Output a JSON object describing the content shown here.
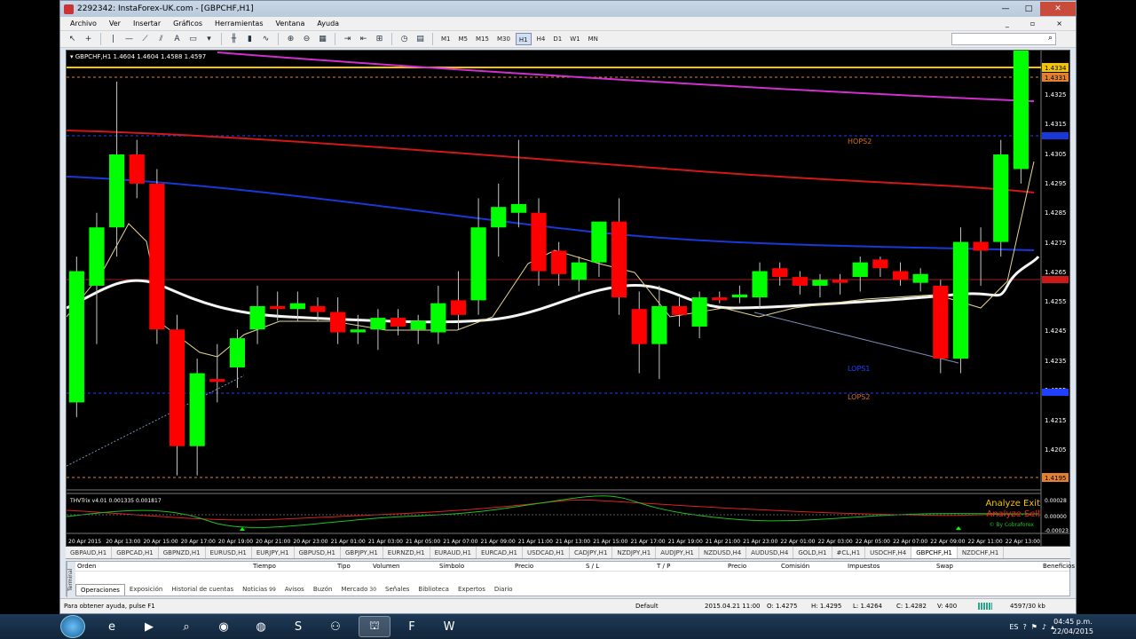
{
  "window": {
    "title": "2292342: InstaForex-UK.com - [GBPCHF,H1]",
    "menu": [
      "Archivo",
      "Ver",
      "Insertar",
      "Gráficos",
      "Herramientas",
      "Ventana",
      "Ayuda"
    ]
  },
  "toolbar": {
    "timeframes": [
      "M1",
      "M5",
      "M15",
      "M30",
      "H1",
      "H4",
      "D1",
      "W1",
      "MN"
    ],
    "active_timeframe": "H1"
  },
  "chart": {
    "header": "GBPCHF,H1  1.4604 1.4604 1.4588 1.4597",
    "price_labels": [
      "1.4325",
      "1.4315",
      "1.4305",
      "1.4295",
      "1.4285",
      "1.4275",
      "1.4265",
      "1.4255",
      "1.4245",
      "1.4235",
      "1.4225",
      "1.4215",
      "1.4205",
      "1.4195"
    ],
    "highlight_labels": [
      {
        "text": "1.4334",
        "color": "#f5c400"
      },
      {
        "text": "1.4331",
        "color": "#e08030"
      },
      {
        "text": "1.4195",
        "color": "#e08030"
      }
    ],
    "levels": [
      {
        "text": "HOPS2",
        "color": "#d07020"
      },
      {
        "text": "LOPS1",
        "color": "#2040ff"
      },
      {
        "text": "LOPS2",
        "color": "#d07020"
      }
    ],
    "time_labels": [
      "20 Apr 2015",
      "20 Apr 13:00",
      "20 Apr 15:00",
      "20 Apr 17:00",
      "20 Apr 19:00",
      "20 Apr 21:00",
      "20 Apr 23:00",
      "21 Apr 01:00",
      "21 Apr 03:00",
      "21 Apr 05:00",
      "21 Apr 07:00",
      "21 Apr 09:00",
      "21 Apr 11:00",
      "21 Apr 13:00",
      "21 Apr 15:00",
      "21 Apr 17:00",
      "21 Apr 19:00",
      "21 Apr 21:00",
      "21 Apr 23:00",
      "22 Apr 01:00",
      "22 Apr 03:00",
      "22 Apr 05:00",
      "22 Apr 07:00",
      "22 Apr 09:00",
      "22 Apr 11:00",
      "22 Apr 13:00"
    ],
    "indicator_header": "THVTrix v4.01 0.001335 0.001817",
    "indicator_labels": [
      "0.00028",
      "0.00000",
      "-0.00023"
    ],
    "watermark": [
      "Analyze Exit",
      "Analyze Sell",
      "© By Cobraforex"
    ]
  },
  "chart_data": {
    "type": "candlestick",
    "ylim": [
      1.419,
      1.434
    ],
    "candles": [
      {
        "o": 1.422,
        "h": 1.427,
        "l": 1.4215,
        "c": 1.4265,
        "color": "green"
      },
      {
        "o": 1.426,
        "h": 1.4285,
        "l": 1.424,
        "c": 1.428,
        "color": "green"
      },
      {
        "o": 1.428,
        "h": 1.433,
        "l": 1.427,
        "c": 1.4305,
        "color": "green"
      },
      {
        "o": 1.4305,
        "h": 1.431,
        "l": 1.429,
        "c": 1.4295,
        "color": "red"
      },
      {
        "o": 1.4295,
        "h": 1.43,
        "l": 1.424,
        "c": 1.4245,
        "color": "red"
      },
      {
        "o": 1.4245,
        "h": 1.425,
        "l": 1.4195,
        "c": 1.4205,
        "color": "red"
      },
      {
        "o": 1.4205,
        "h": 1.4235,
        "l": 1.4195,
        "c": 1.423,
        "color": "green"
      },
      {
        "o": 1.4228,
        "h": 1.424,
        "l": 1.422,
        "c": 1.4227,
        "color": "red"
      },
      {
        "o": 1.4232,
        "h": 1.4245,
        "l": 1.4225,
        "c": 1.4242,
        "color": "green"
      },
      {
        "o": 1.4245,
        "h": 1.426,
        "l": 1.424,
        "c": 1.4253,
        "color": "green"
      },
      {
        "o": 1.4253,
        "h": 1.4258,
        "l": 1.4248,
        "c": 1.4252,
        "color": "red"
      },
      {
        "o": 1.4252,
        "h": 1.4258,
        "l": 1.4248,
        "c": 1.4254,
        "color": "green"
      },
      {
        "o": 1.4253,
        "h": 1.4256,
        "l": 1.4248,
        "c": 1.4251,
        "color": "red"
      },
      {
        "o": 1.4251,
        "h": 1.4256,
        "l": 1.424,
        "c": 1.4244,
        "color": "red"
      },
      {
        "o": 1.4244,
        "h": 1.425,
        "l": 1.424,
        "c": 1.4245,
        "color": "green"
      },
      {
        "o": 1.4245,
        "h": 1.4252,
        "l": 1.4238,
        "c": 1.4249,
        "color": "green"
      },
      {
        "o": 1.4249,
        "h": 1.4252,
        "l": 1.4243,
        "c": 1.4246,
        "color": "red"
      },
      {
        "o": 1.4245,
        "h": 1.425,
        "l": 1.424,
        "c": 1.4248,
        "color": "green"
      },
      {
        "o": 1.4244,
        "h": 1.426,
        "l": 1.424,
        "c": 1.4254,
        "color": "green"
      },
      {
        "o": 1.425,
        "h": 1.4265,
        "l": 1.4245,
        "c": 1.4255,
        "color": "red"
      },
      {
        "o": 1.4255,
        "h": 1.429,
        "l": 1.425,
        "c": 1.428,
        "color": "green"
      },
      {
        "o": 1.428,
        "h": 1.4295,
        "l": 1.427,
        "c": 1.4287,
        "color": "green"
      },
      {
        "o": 1.4288,
        "h": 1.431,
        "l": 1.428,
        "c": 1.4285,
        "color": "green"
      },
      {
        "o": 1.4285,
        "h": 1.429,
        "l": 1.426,
        "c": 1.4265,
        "color": "red"
      },
      {
        "o": 1.4272,
        "h": 1.4275,
        "l": 1.426,
        "c": 1.4264,
        "color": "red"
      },
      {
        "o": 1.4262,
        "h": 1.427,
        "l": 1.4258,
        "c": 1.4268,
        "color": "green"
      },
      {
        "o": 1.4268,
        "h": 1.4282,
        "l": 1.4263,
        "c": 1.4282,
        "color": "green"
      },
      {
        "o": 1.4282,
        "h": 1.429,
        "l": 1.425,
        "c": 1.4256,
        "color": "red"
      },
      {
        "o": 1.4252,
        "h": 1.4258,
        "l": 1.423,
        "c": 1.424,
        "color": "red"
      },
      {
        "o": 1.424,
        "h": 1.426,
        "l": 1.4228,
        "c": 1.4253,
        "color": "green"
      },
      {
        "o": 1.4253,
        "h": 1.4256,
        "l": 1.4246,
        "c": 1.425,
        "color": "red"
      },
      {
        "o": 1.4246,
        "h": 1.4258,
        "l": 1.4242,
        "c": 1.4256,
        "color": "green"
      },
      {
        "o": 1.4256,
        "h": 1.4258,
        "l": 1.4254,
        "c": 1.4255,
        "color": "red"
      },
      {
        "o": 1.4256,
        "h": 1.426,
        "l": 1.4254,
        "c": 1.4257,
        "color": "green"
      },
      {
        "o": 1.4256,
        "h": 1.4268,
        "l": 1.4252,
        "c": 1.4265,
        "color": "green"
      },
      {
        "o": 1.4266,
        "h": 1.4268,
        "l": 1.426,
        "c": 1.4263,
        "color": "red"
      },
      {
        "o": 1.4263,
        "h": 1.4265,
        "l": 1.4257,
        "c": 1.426,
        "color": "red"
      },
      {
        "o": 1.426,
        "h": 1.4264,
        "l": 1.4256,
        "c": 1.4262,
        "color": "green"
      },
      {
        "o": 1.4261,
        "h": 1.4264,
        "l": 1.4257,
        "c": 1.4262,
        "color": "red"
      },
      {
        "o": 1.4263,
        "h": 1.427,
        "l": 1.4258,
        "c": 1.4268,
        "color": "green"
      },
      {
        "o": 1.4269,
        "h": 1.427,
        "l": 1.4263,
        "c": 1.4266,
        "color": "red"
      },
      {
        "o": 1.4265,
        "h": 1.4268,
        "l": 1.426,
        "c": 1.4262,
        "color": "red"
      },
      {
        "o": 1.4261,
        "h": 1.4266,
        "l": 1.4258,
        "c": 1.4264,
        "color": "green"
      },
      {
        "o": 1.426,
        "h": 1.4262,
        "l": 1.423,
        "c": 1.4235,
        "color": "red"
      },
      {
        "o": 1.4235,
        "h": 1.428,
        "l": 1.423,
        "c": 1.4275,
        "color": "green"
      },
      {
        "o": 1.4275,
        "h": 1.428,
        "l": 1.426,
        "c": 1.4272,
        "color": "red"
      },
      {
        "o": 1.4275,
        "h": 1.431,
        "l": 1.427,
        "c": 1.4305,
        "color": "green"
      },
      {
        "o": 1.43,
        "h": 1.4342,
        "l": 1.4295,
        "c": 1.4342,
        "color": "green"
      }
    ]
  },
  "symbol_tabs": [
    "GBPAUD,H1",
    "GBPCAD,H1",
    "GBPNZD,H1",
    "EURUSD,H1",
    "EURJPY,H1",
    "GBPUSD,H1",
    "GBPJPY,H1",
    "EURNZD,H1",
    "EURAUD,H1",
    "EURCAD,H1",
    "USDCAD,H1",
    "CADJPY,H1",
    "NZDJPY,H1",
    "AUDJPY,H1",
    "NZDUSD,H4",
    "AUDUSD,H4",
    "GOLD,H1",
    "#CL,H1",
    "USDCHF,H4",
    "GBPCHF,H1",
    "NZDCHF,H1"
  ],
  "active_symbol_tab": "GBPCHF,H1",
  "terminal": {
    "side_label": "Terminal",
    "columns": [
      "Orden",
      "Tiempo",
      "Tipo",
      "Volumen",
      "Símbolo",
      "Precio",
      "S / L",
      "T / P",
      "Precio",
      "Comisión",
      "Impuestos",
      "Swap",
      "Beneficios"
    ],
    "tabs": [
      "Operaciones",
      "Exposición",
      "Historial de cuentas",
      "Noticias",
      "Avisos",
      "Buzón",
      "Mercado",
      "Señales",
      "Biblioteca",
      "Expertos",
      "Diario"
    ],
    "noticias_badge": "99",
    "mercado_badge": "30"
  },
  "status": {
    "help": "Para obtener ayuda, pulse F1",
    "profile": "Default",
    "datetime": "2015.04.21 11:00",
    "open": "O: 1.4275",
    "high": "H: 1.4295",
    "low": "L: 1.4264",
    "close": "C: 1.4282",
    "volume": "V: 400",
    "traffic": "4597/30 kb"
  },
  "taskbar": {
    "lang": "ES",
    "time": "04:45 p.m.",
    "date": "22/04/2015"
  }
}
